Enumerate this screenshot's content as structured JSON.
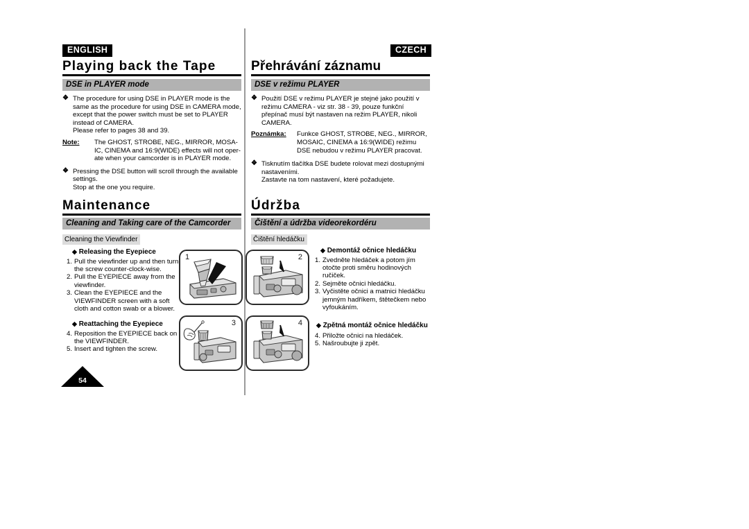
{
  "page": {
    "number": "54"
  },
  "columns": {
    "english": {
      "language_badge": "ENGLISH",
      "chapter_title": "Playing back the Tape",
      "section_header": "DSE in PLAYER mode",
      "bullets": [
        {
          "marker": "❖",
          "text": "The procedure for using DSE in PLAYER mode is the same as the procedure for using DSE in CAMERA mode, except that the power switch must be set to PLAYER instead of CAMERA.\nPlease refer to pages 38 and 39."
        }
      ],
      "note": {
        "label": "Note:",
        "text": "The GHOST, STROBE, NEG., MIRROR, MOSA-IC, CINEMA and 16:9(WIDE) effects will not oper-ate when your camcorder is in PLAYER mode."
      },
      "bullets2": [
        {
          "marker": "❖",
          "text": "Pressing the DSE button will scroll through the available settings.\nStop at the one you require."
        }
      ],
      "chapter_title_2": "Maintenance",
      "section_header_2": "Cleaning and Taking care of the Camcorder",
      "sub_label": "Cleaning the Viewfinder",
      "group_a": {
        "heading": "Releasing the Eyepiece",
        "diamond": "◆",
        "steps": [
          {
            "num": "1.",
            "text": "Pull the viewfinder up and then turn the screw counter-clock-wise."
          },
          {
            "num": "2.",
            "text": "Pull the EYEPIECE away from the viewfinder."
          },
          {
            "num": "3.",
            "text": "Clean the EYEPIECE and the VIEWFINDER screen with a soft cloth and cotton swab or a blower."
          }
        ]
      },
      "group_b": {
        "heading": "Reattaching the Eyepiece",
        "diamond": "◆",
        "steps": [
          {
            "num": "4.",
            "text": "Reposition the EYEPIECE back on the VIEWFINDER."
          },
          {
            "num": "5.",
            "text": "Insert and tighten the screw."
          }
        ]
      }
    },
    "czech": {
      "language_badge": "CZECH",
      "chapter_title": "Přehrávání záznamu",
      "section_header": "DSE v režimu PLAYER",
      "bullets": [
        {
          "marker": "❖",
          "text": "Použití DSE v režimu PLAYER je stejné jako použití v režimu CAMERA - viz str. 38 - 39, pouze funkční přepínač musí být nastaven na režim PLAYER, nikoli CAMERA."
        }
      ],
      "note": {
        "label": "Poznámka:",
        "text": "Funkce GHOST, STROBE, NEG., MIRROR, MOSAIC, CINEMA a 16:9(WIDE) režimu DSE nebudou v režimu PLAYER pracovat."
      },
      "bullets2": [
        {
          "marker": "❖",
          "text": "Tisknutím tlačítka DSE budete rolovat mezi dostupnými nastaveními.\nZastavte na tom nastavení, které požadujete."
        }
      ],
      "chapter_title_2": "Údržba",
      "section_header_2": "Čištění a údržba videorekordéru",
      "sub_label": "Čištění hledáčku",
      "group_a": {
        "heading": "Demontáž očnice hledáčku",
        "diamond": "◆",
        "steps": [
          {
            "num": "1.",
            "text": "Zvedněte hledáček a potom jím otočte proti směru hodinových ručiček."
          },
          {
            "num": "2.",
            "text": "Sejměte očnici hledáčku."
          },
          {
            "num": "3.",
            "text": "Vyčistěte očnici a matnici hledáčku jemným hadříkem, štětečkem nebo vyfoukáním."
          }
        ]
      },
      "group_b": {
        "heading": "Zpětná montáž očnice hledáčku",
        "diamond": "◆",
        "steps": [
          {
            "num": "4.",
            "text": "Přiložte očnici na hledáček."
          },
          {
            "num": "5.",
            "text": "Našroubujte ji zpět."
          }
        ]
      }
    }
  },
  "illustrations": [
    {
      "index": "1",
      "caption_semantic": "camcorder-viewfinder-release"
    },
    {
      "index": "2",
      "caption_semantic": "camcorder-eyepiece-removal"
    },
    {
      "index": "3",
      "caption_semantic": "camcorder-eyepiece-cleaning"
    },
    {
      "index": "4",
      "caption_semantic": "camcorder-eyepiece-reattach"
    }
  ],
  "colors": {
    "section_bar": "#b2b2b2",
    "sub_label_bg": "#dcdcdc",
    "rule": "#000000",
    "divider": "#9a9a9a",
    "badge_bg": "#000000",
    "badge_fg": "#ffffff"
  }
}
